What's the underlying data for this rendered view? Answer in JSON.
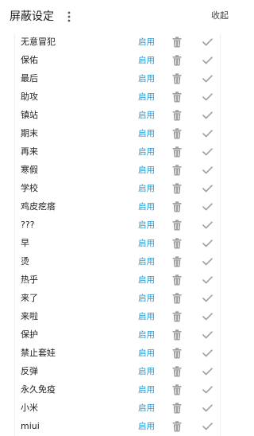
{
  "header": {
    "title": "屏蔽设定",
    "more_icon": "vertical-dots-icon",
    "collapse_label": "收起"
  },
  "colors": {
    "accent": "#1e9bd8",
    "icon": "#9e9e9e"
  },
  "list": {
    "enable_label": "启用",
    "items": [
      {
        "label": "无意冒犯"
      },
      {
        "label": "保佑"
      },
      {
        "label": "最后"
      },
      {
        "label": "助攻"
      },
      {
        "label": "镇站"
      },
      {
        "label": "期末"
      },
      {
        "label": "再来"
      },
      {
        "label": "寒假"
      },
      {
        "label": "学校"
      },
      {
        "label": "鸡皮疙瘩"
      },
      {
        "label": "???"
      },
      {
        "label": "早"
      },
      {
        "label": "烫"
      },
      {
        "label": "热乎"
      },
      {
        "label": "来了"
      },
      {
        "label": "来啦"
      },
      {
        "label": "保护"
      },
      {
        "label": "禁止套娃"
      },
      {
        "label": "反弹"
      },
      {
        "label": "永久免疫"
      },
      {
        "label": "小米"
      },
      {
        "label": "miui"
      }
    ]
  }
}
